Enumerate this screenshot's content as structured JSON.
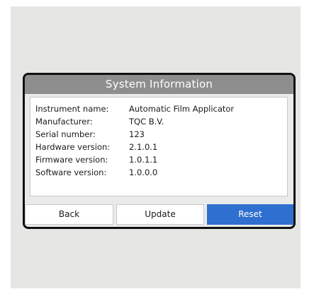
{
  "dialog": {
    "title": "System Information"
  },
  "info": {
    "rows": [
      {
        "label": "Instrument name:",
        "value": "Automatic Film Applicator"
      },
      {
        "label": "Manufacturer:",
        "value": "TQC B.V."
      },
      {
        "label": "Serial number:",
        "value": "123"
      },
      {
        "label": "Hardware version:",
        "value": "2.1.0.1"
      },
      {
        "label": "Firmware version:",
        "value": "1.0.1.1"
      },
      {
        "label": "Software version:",
        "value": "1.0.0.0"
      }
    ]
  },
  "buttons": {
    "back_label": "Back",
    "update_label": "Update",
    "reset_label": "Reset"
  },
  "colors": {
    "title_bar": "#8e8e8e",
    "accent": "#2e6fcf",
    "bezel": "#111111",
    "backdrop": "#e6e6e4"
  }
}
